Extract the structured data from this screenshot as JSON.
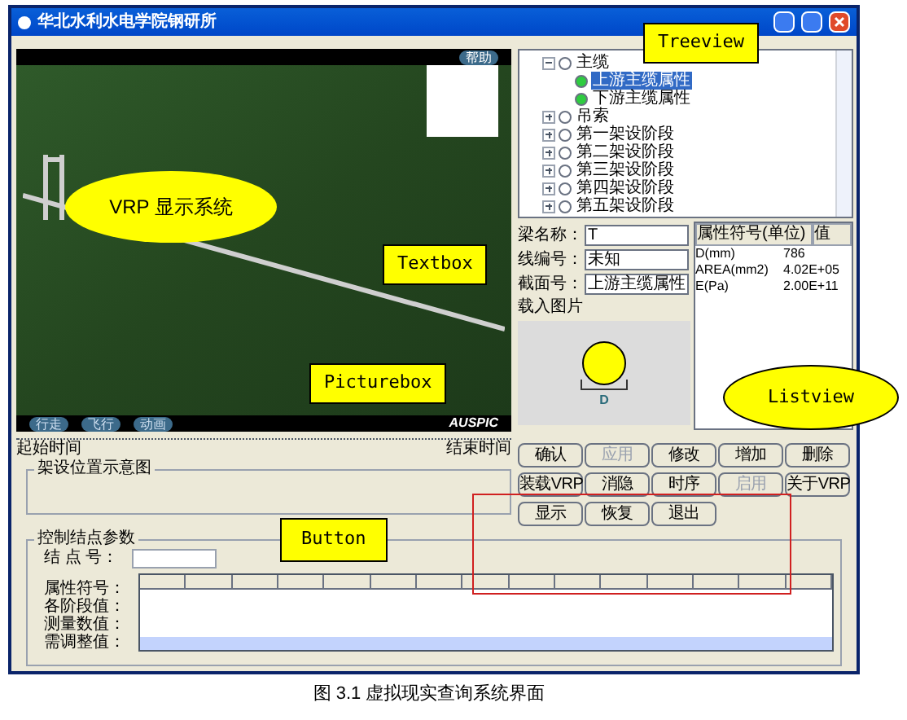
{
  "window": {
    "title": "华北水利水电学院钢研所"
  },
  "viewer": {
    "help_button": "帮助",
    "nav_buttons": [
      {
        "label": "行走"
      },
      {
        "label": "飞行"
      },
      {
        "label": "动画"
      }
    ],
    "logo": "AUSPIC"
  },
  "tree": [
    {
      "label": "主缆",
      "expanded": true,
      "children": [
        {
          "label": "上游主缆属性",
          "selected": true
        },
        {
          "label": "下游主缆属性",
          "selected": false
        }
      ]
    },
    {
      "label": "吊索",
      "expanded": false
    },
    {
      "label": "第一架设阶段",
      "expanded": false
    },
    {
      "label": "第二架设阶段",
      "expanded": false
    },
    {
      "label": "第三架设阶段",
      "expanded": false
    },
    {
      "label": "第四架设阶段",
      "expanded": false
    },
    {
      "label": "第五架设阶段",
      "expanded": false
    }
  ],
  "fields": [
    {
      "label": "梁名称：",
      "value": "T"
    },
    {
      "label": "线编号：",
      "value": "未知"
    },
    {
      "label": "截面号：",
      "value": "上游主缆属性"
    }
  ],
  "picture": {
    "label": "载入图片",
    "dimension": "D"
  },
  "listview": {
    "columns": [
      "属性符号(单位)",
      "值"
    ],
    "rows": [
      [
        "D(mm)",
        "786"
      ],
      [
        "AREA(mm2)",
        "4.02E+05"
      ],
      [
        "E(Pa)",
        "2.00E+11"
      ]
    ]
  },
  "timeline": {
    "start_label": "起始时间",
    "end_label": "结束时间"
  },
  "groups": {
    "position": "架设位置示意图",
    "control": "控制结点参数"
  },
  "node": {
    "label": "结 点 号：",
    "row_labels": [
      "属性符号：",
      "各阶段值：",
      "测量数值：",
      "需调整值："
    ]
  },
  "buttons": [
    {
      "label": "确认",
      "disabled": false
    },
    {
      "label": "应用",
      "disabled": true
    },
    {
      "label": "修改",
      "disabled": false
    },
    {
      "label": "增加",
      "disabled": false
    },
    {
      "label": "删除",
      "disabled": false
    },
    {
      "label": "装载VRP",
      "disabled": false
    },
    {
      "label": "消隐",
      "disabled": false
    },
    {
      "label": "时序",
      "disabled": false
    },
    {
      "label": "启用",
      "disabled": true
    },
    {
      "label": "关于VRP",
      "disabled": false
    },
    {
      "label": "显示",
      "disabled": false
    },
    {
      "label": "恢复",
      "disabled": false
    },
    {
      "label": "退出",
      "disabled": false
    }
  ],
  "annotations": [
    {
      "kind": "cloud",
      "text": "VRP 显示系统"
    },
    {
      "kind": "callout",
      "text": "Treeview"
    },
    {
      "kind": "callout",
      "text": "Textbox"
    },
    {
      "kind": "callout",
      "text": "Picturebox"
    },
    {
      "kind": "oval",
      "text": "Listview"
    },
    {
      "kind": "callout",
      "text": "Button"
    }
  ],
  "caption": "图 3.1 虚拟现实查询系统界面"
}
